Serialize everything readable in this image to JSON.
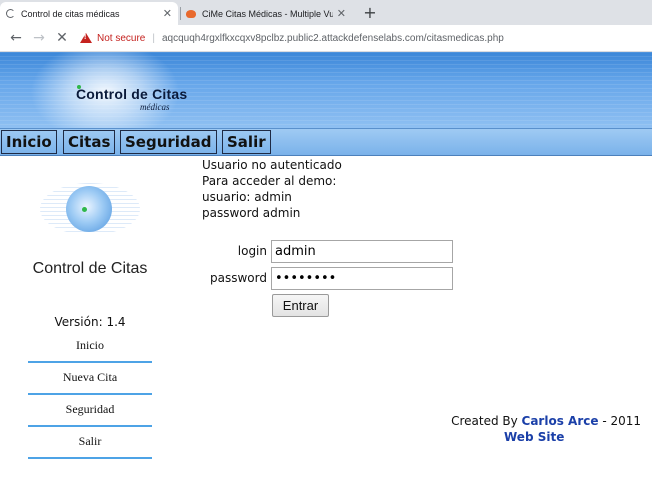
{
  "browser": {
    "tabs": [
      {
        "title": "Control de citas médicas",
        "active": true
      },
      {
        "title": "CiMe Citas Médicas - Multiple Vu",
        "active": false
      }
    ],
    "new_tab_label": "+",
    "security_label": "Not secure",
    "address_separator": "|",
    "url": "aqcquqh4rgxlfkxcqxv8pclbz.public2.attackdefenselabs.com/citasmedicas.php",
    "icons": {
      "back": "back-arrow-icon",
      "forward": "forward-arrow-icon",
      "reload": "stop-loading-icon",
      "warning": "warning-icon"
    }
  },
  "header": {
    "title": "Control de Citas",
    "subtitle": "médicas"
  },
  "menu": {
    "items": [
      "Inicio",
      "Citas",
      "Seguridad",
      "Salir"
    ]
  },
  "sidebar": {
    "title": "Control de Citas",
    "version": "Versión: 1.4",
    "links": [
      "Inicio",
      "Nueva Cita",
      "Seguridad",
      "Salir"
    ]
  },
  "main": {
    "status": "Usuario no autenticado",
    "demo_intro": "Para acceder al demo:",
    "demo_user": "usuario: admin",
    "demo_password": "password admin",
    "login_label": "login",
    "login_value": "admin",
    "password_label": "password",
    "password_value": "••••••••",
    "submit_label": "Entrar"
  },
  "footer": {
    "created_by": "Created By ",
    "author": "Carlos Arce",
    "year": " - 2011",
    "website": "Web Site"
  },
  "colors": {
    "banner": "#66a6ea",
    "menu": "#9fcaf3",
    "link": "#1a3fa8",
    "sidebar_underline": "#4da3e6",
    "warning": "#c5221f"
  }
}
